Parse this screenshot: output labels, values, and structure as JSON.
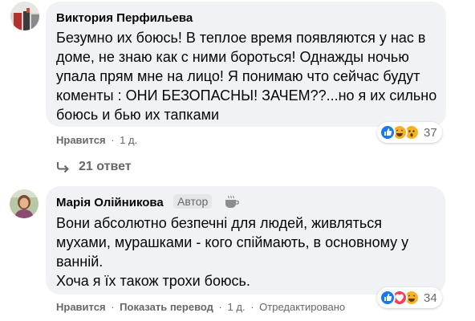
{
  "comments": [
    {
      "author": "Виктория Перфильева",
      "text": "Безумно их боюсь! В теплое время появляются у нас в\nдоме, не знаю как с ними бороться! Однажды ночью\nупала прям мне на лицо! Я понимаю что сейчас будут\nкоменты : ОНИ БЕЗОПАСНЫ! ЗАЧЕМ??...но я их сильно\nбоюсь и бью их тапками",
      "like_label": "Нравится",
      "separator": "·",
      "time": "1 д.",
      "reaction_count": "37",
      "reactions": [
        "like-icon",
        "haha-icon",
        "wow-icon"
      ]
    },
    {
      "author": "Марія Олійникова",
      "badge": "Автор",
      "text": "Вони абсолютно безпечні для людей, живляться\nмухами, мурашками - кого спіймають, в основному у\nванній.\nХоча я їх також трохи боюсь.",
      "like_label": "Нравится",
      "translate_label": "Показать перевод",
      "separator": "·",
      "time": "1 д.",
      "edited_label": "Отредактировано",
      "reaction_count": "34",
      "reactions": [
        "like-icon",
        "love-icon",
        "haha-icon"
      ]
    }
  ],
  "replies_label": "21 ответ",
  "colors": {
    "bubble": "#f0f2f5",
    "secondary_text": "#65676b",
    "like": "#1877f2",
    "love": "#f33e58",
    "haha": "#f7b125"
  }
}
